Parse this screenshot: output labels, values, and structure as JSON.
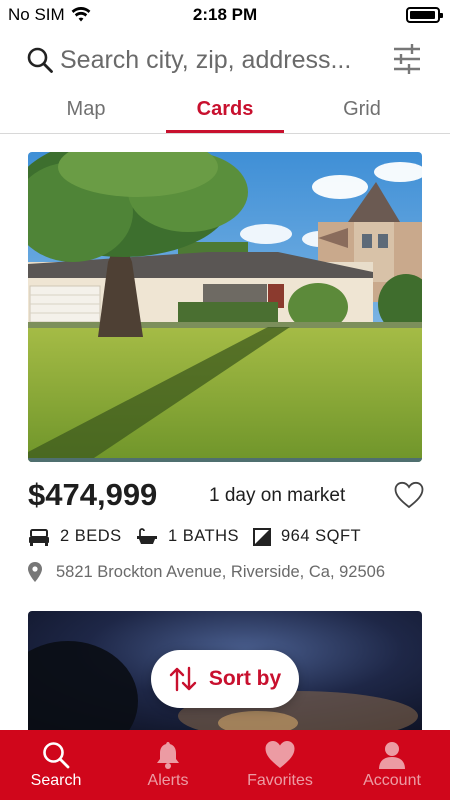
{
  "status_bar": {
    "carrier": "No SIM",
    "time": "2:18 PM"
  },
  "search": {
    "placeholder": "Search city, zip, address..."
  },
  "tabs": [
    {
      "label": "Map",
      "active": false
    },
    {
      "label": "Cards",
      "active": true
    },
    {
      "label": "Grid",
      "active": false
    }
  ],
  "listing": {
    "price": "$474,999",
    "days_on_market": "1 day on market",
    "beds": "2 BEDS",
    "baths": "1 BATHS",
    "sqft": "964 SQFT",
    "address": "5821 Brockton Avenue, Riverside, Ca, 92506"
  },
  "sort_button": {
    "label": "Sort by"
  },
  "bottom_nav": [
    {
      "label": "Search",
      "icon": "search-icon",
      "active": true
    },
    {
      "label": "Alerts",
      "icon": "bell-icon",
      "active": false
    },
    {
      "label": "Favorites",
      "icon": "heart-icon",
      "active": false
    },
    {
      "label": "Account",
      "icon": "user-icon",
      "active": false
    }
  ],
  "colors": {
    "brand_red": "#c8102e",
    "nav_red": "#d0061b"
  }
}
